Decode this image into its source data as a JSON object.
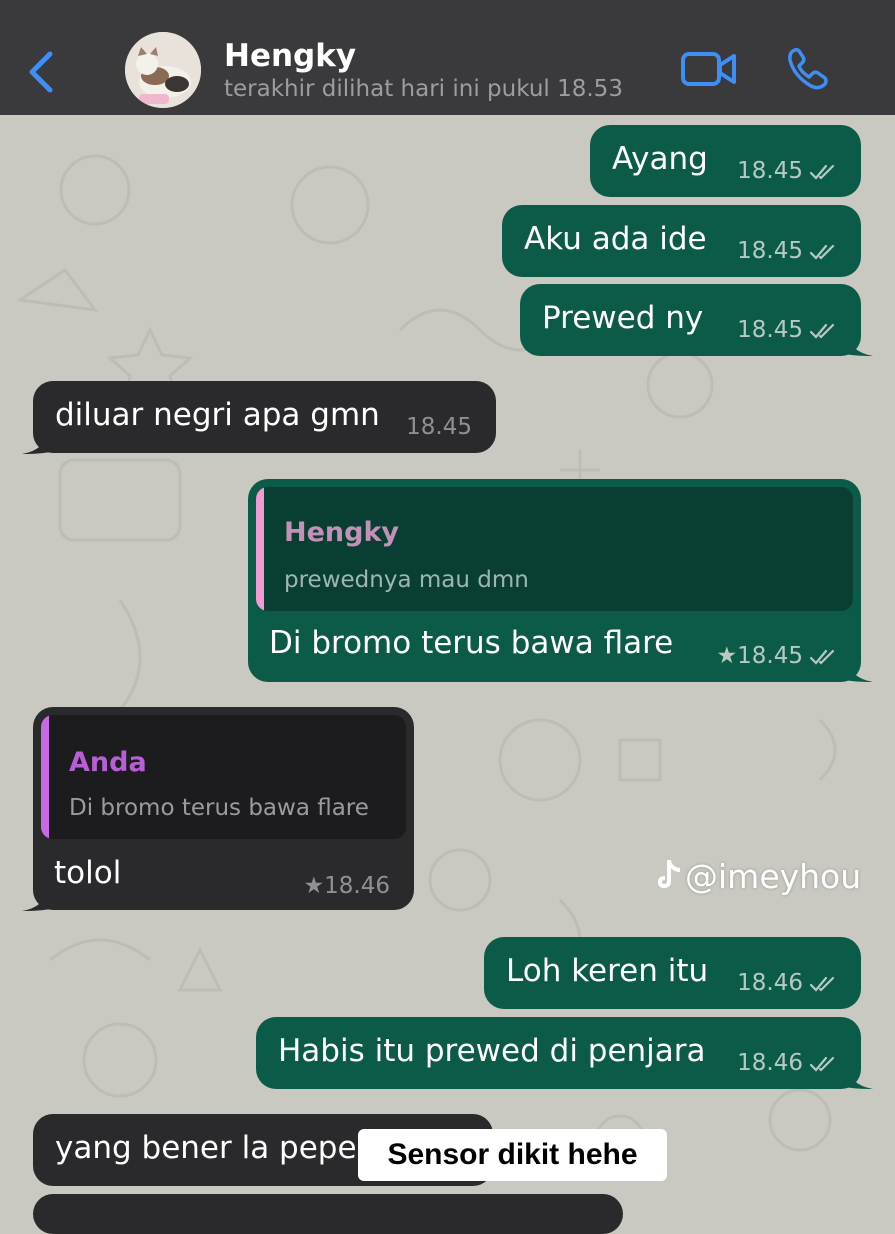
{
  "header": {
    "contact_name": "Hengky",
    "last_seen": "terakhir dilihat hari ini pukul 18.53",
    "back_icon": "chevron-left-icon",
    "video_icon": "video-camera-icon",
    "call_icon": "phone-icon",
    "accent_color": "#3d8ff5"
  },
  "messages": [
    {
      "direction": "outgoing",
      "text": "Ayang",
      "time": "18.45",
      "status": "read"
    },
    {
      "direction": "outgoing",
      "text": "Aku ada ide",
      "time": "18.45",
      "status": "read"
    },
    {
      "direction": "outgoing",
      "text": "Prewed ny",
      "time": "18.45",
      "status": "read"
    },
    {
      "direction": "incoming",
      "text": "diluar negri apa gmn",
      "time": "18.45"
    },
    {
      "direction": "outgoing",
      "quote": {
        "name": "Hengky",
        "text": "prewednya mau dmn"
      },
      "text": "Di bromo terus bawa flare",
      "time": "★18.45",
      "status": "read",
      "starred": true
    },
    {
      "direction": "incoming",
      "quote": {
        "name": "Anda",
        "text": "Di bromo terus bawa flare"
      },
      "text": "tolol",
      "time": "★18.46",
      "starred": true
    },
    {
      "direction": "outgoing",
      "text": "Loh keren itu",
      "time": "18.46",
      "status": "read"
    },
    {
      "direction": "outgoing",
      "text": "Habis itu prewed di penjara",
      "time": "18.46",
      "status": "read"
    },
    {
      "direction": "incoming",
      "text": "yang bener la pepe"
    }
  ],
  "overlay": {
    "watermark": "@imeyhou",
    "sticker": "Sensor dikit hehe"
  },
  "colors": {
    "outgoing_bubble": "#0b5b48",
    "incoming_bubble": "#2a2a2c",
    "header_bg": "#3a3a3c",
    "chat_bg": "#c9c9c1",
    "quote_out_name": "#c490b8",
    "quote_out_bar": "#f29bd2",
    "quote_in_name": "#b85fd6",
    "quote_in_bar": "#c86be3"
  }
}
